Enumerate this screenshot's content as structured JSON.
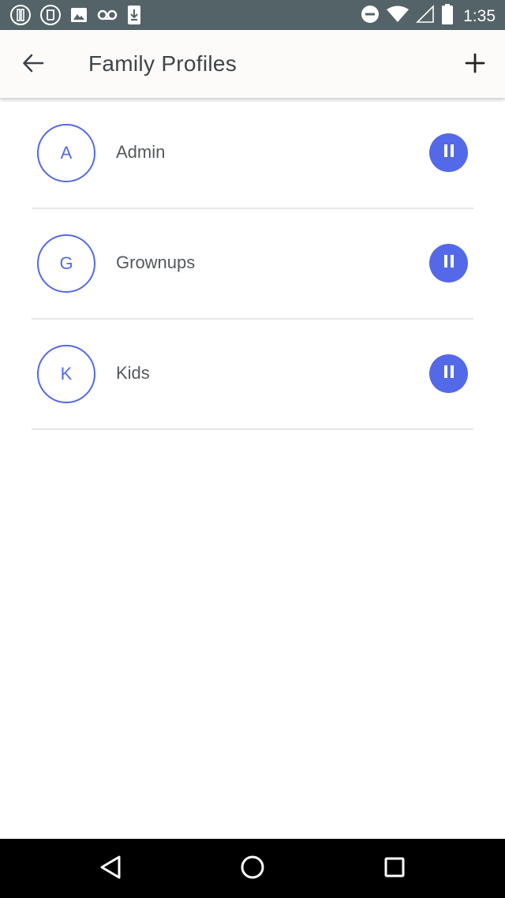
{
  "status_bar": {
    "time": "1:35",
    "left_icons": [
      "notification-icon",
      "notification-icon",
      "image-icon",
      "voicemail-icon",
      "download-icon"
    ],
    "right_icons": [
      "do-not-disturb-icon",
      "wifi-icon",
      "signal-icon",
      "battery-icon"
    ]
  },
  "app_bar": {
    "title": "Family Profiles",
    "back_icon": "arrow-left-icon",
    "add_icon": "plus-icon"
  },
  "profiles": [
    {
      "initial": "A",
      "name": "Admin"
    },
    {
      "initial": "G",
      "name": "Grownups"
    },
    {
      "initial": "K",
      "name": "Kids"
    }
  ],
  "colors": {
    "accent": "#5469e8",
    "status_bar": "#546368",
    "app_bar": "#fcfbf9",
    "text": "#54595c",
    "nav_bar": "#000000"
  }
}
